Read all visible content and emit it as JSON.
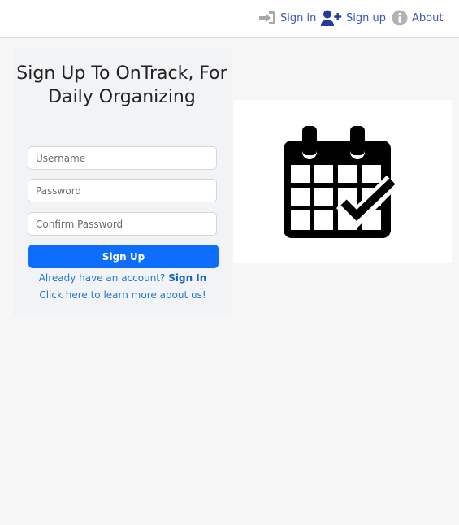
{
  "nav": {
    "signin": {
      "label": "Sign in",
      "icon": "sign-in-icon"
    },
    "signup": {
      "label": "Sign up",
      "icon": "user-plus-icon"
    },
    "about": {
      "label": "About",
      "icon": "info-icon"
    }
  },
  "form": {
    "title": "Sign Up To OnTrack, For Daily Organizing",
    "username_placeholder": "Username",
    "password_placeholder": "Password",
    "confirm_placeholder": "Confirm Password",
    "submit_label": "Sign Up",
    "account_prompt": "Already have an account?",
    "account_link": "Sign In",
    "learn_more": "Click here to learn more about us!"
  },
  "illustration": {
    "icon": "calendar-check-icon"
  },
  "colors": {
    "accent": "#0d6efd",
    "nav_text": "#3554c7",
    "link": "#1f76d2"
  }
}
